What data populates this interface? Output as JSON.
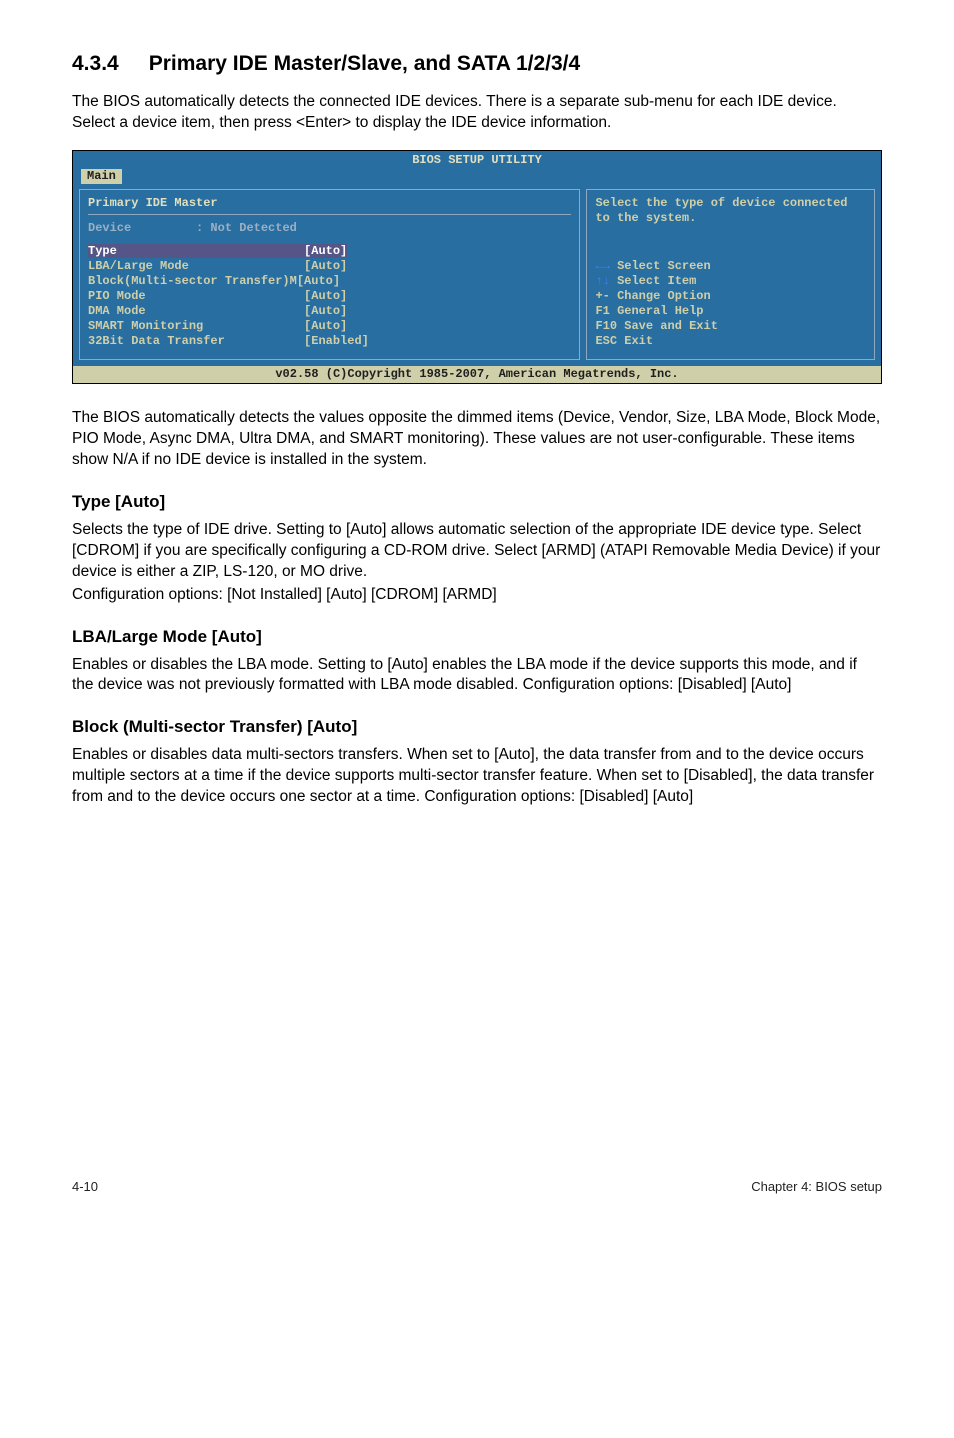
{
  "section": {
    "number": "4.3.4",
    "title": "Primary IDE Master/Slave, and SATA 1/2/3/4"
  },
  "intro": "The BIOS automatically detects the connected IDE devices. There is a separate sub-menu for each IDE device. Select a device item, then press <Enter> to display the IDE device information.",
  "bios": {
    "title": "BIOS SETUP UTILITY",
    "tab": "Main",
    "header": "Primary IDE Master",
    "device_label": "Device",
    "device_value": ": Not Detected",
    "rows": [
      {
        "label": "Type",
        "value": "[Auto]",
        "hi": true
      },
      {
        "label": "LBA/Large Mode",
        "value": "[Auto]"
      },
      {
        "label": "Block(Multi-sector Transfer)M",
        "value": "[Auto]"
      },
      {
        "label": "PIO Mode",
        "value": "[Auto]"
      },
      {
        "label": "DMA Mode",
        "value": "[Auto]"
      },
      {
        "label": "SMART Monitoring",
        "value": "[Auto]"
      },
      {
        "label": "32Bit Data Transfer",
        "value": "[Enabled]"
      }
    ],
    "help": "Select the type of device connected to the system.",
    "legend": {
      "l1a": "←→",
      "l1b": "Select Screen",
      "l2a": "↑↓",
      "l2b": "Select Item",
      "l3a": "+-",
      "l3b": "Change Option",
      "l4a": "F1",
      "l4b": "General Help",
      "l5a": "F10",
      "l5b": "Save and Exit",
      "l6a": "ESC",
      "l6b": "Exit"
    },
    "footer": "v02.58 (C)Copyright 1985-2007, American Megatrends, Inc."
  },
  "after_bios": "The BIOS automatically detects the values opposite the dimmed items (Device, Vendor, Size, LBA Mode, Block Mode, PIO Mode, Async DMA, Ultra DMA, and SMART monitoring). These values are not user-configurable. These items show N/A if no IDE device is installed in the system.",
  "type": {
    "heading": "Type [Auto]",
    "p1": "Selects the type of IDE drive. Setting to [Auto] allows automatic selection of the appropriate IDE device type. Select [CDROM] if you are specifically configuring a CD-ROM drive. Select [ARMD] (ATAPI Removable Media Device) if your device is either a ZIP, LS-120, or MO drive.",
    "p2": "Configuration options: [Not Installed] [Auto] [CDROM] [ARMD]"
  },
  "lba": {
    "heading": "LBA/Large Mode [Auto]",
    "p": "Enables or disables the LBA mode. Setting to [Auto] enables the LBA mode if the device supports this mode, and if the device was not previously formatted with LBA mode disabled. Configuration options: [Disabled] [Auto]"
  },
  "block": {
    "heading": "Block (Multi-sector Transfer) [Auto]",
    "p": "Enables or disables data multi-sectors transfers. When set to [Auto], the data transfer from and to the device occurs multiple sectors at a time if the device supports multi-sector transfer feature. When set to [Disabled], the data transfer from and to the device occurs one sector at a time. Configuration options: [Disabled] [Auto]"
  },
  "footer": {
    "left": "4-10",
    "right": "Chapter 4: BIOS setup"
  }
}
